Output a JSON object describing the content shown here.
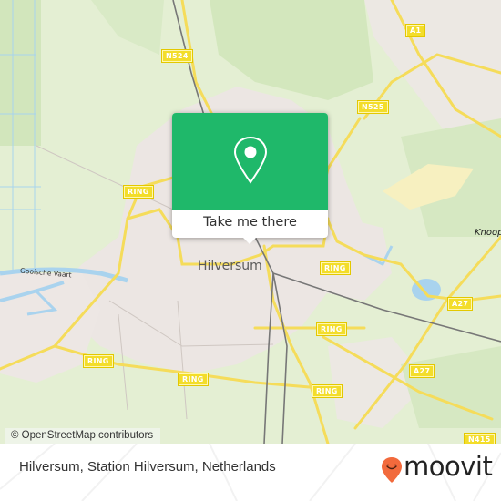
{
  "map": {
    "city_label": "Hilversum",
    "water_label": "Gooische Vaart",
    "partial_label": "Knoop",
    "road_shields": [
      {
        "id": "ring-west",
        "label": "RING"
      },
      {
        "id": "ring-east",
        "label": "RING"
      },
      {
        "id": "ring-center-east",
        "label": "RING"
      },
      {
        "id": "ring-southwest",
        "label": "RING"
      },
      {
        "id": "ring-south",
        "label": "RING"
      },
      {
        "id": "ring-southeast",
        "label": "RING"
      },
      {
        "id": "n524",
        "label": "N524"
      },
      {
        "id": "n525",
        "label": "N525"
      },
      {
        "id": "a1",
        "label": "A1"
      },
      {
        "id": "a27-north",
        "label": "A27"
      },
      {
        "id": "a27-south",
        "label": "A27"
      },
      {
        "id": "n415",
        "label": "N415"
      }
    ],
    "attribution": "© OpenStreetMap contributors"
  },
  "popup": {
    "icon": "map-pin-icon",
    "button_label": "Take me there",
    "accent_color": "#1fb86a"
  },
  "footer": {
    "address": "Hilversum, Station Hilversum, Netherlands",
    "brand": "moovit",
    "brand_color": "#f26a3c"
  }
}
